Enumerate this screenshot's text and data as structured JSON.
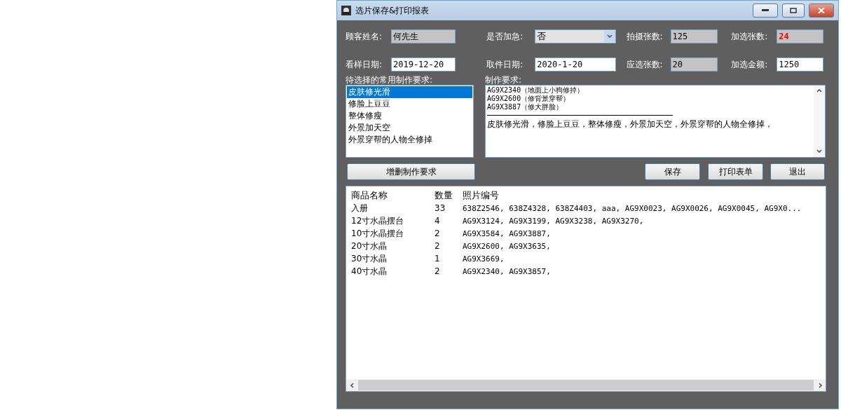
{
  "window": {
    "title": "选片保存&打印报表"
  },
  "fields": [
    {
      "label": "顾客姓名:",
      "value": "何先生",
      "kind": "readonly",
      "highlight": false
    },
    {
      "label": "是否加急:",
      "value": "否",
      "kind": "combo",
      "highlight": false
    },
    {
      "label": "拍摄张数:",
      "value": "125",
      "kind": "readonly",
      "highlight": false
    },
    {
      "label": "加选张数:",
      "value": "24",
      "kind": "readonly",
      "highlight": true
    },
    {
      "label": "看样日期:",
      "value": "2019-12-20",
      "kind": "input",
      "highlight": false
    },
    {
      "label": "取件日期:",
      "value": "2020-1-20",
      "kind": "input",
      "highlight": false
    },
    {
      "label": "应选张数:",
      "value": "20",
      "kind": "readonly",
      "highlight": false
    },
    {
      "label": "加选金额:",
      "value": "1250",
      "kind": "input",
      "highlight": false
    }
  ],
  "common_requirements": {
    "label": "待选择的常用制作要求:",
    "items": [
      {
        "text": "皮肤修光滑",
        "selected": true
      },
      {
        "text": "修脸上豆豆",
        "selected": false
      },
      {
        "text": "整体修瘦",
        "selected": false
      },
      {
        "text": "外景加天空",
        "selected": false
      },
      {
        "text": "外景穿帮的人物全修掉",
        "selected": false
      }
    ]
  },
  "requirements": {
    "label": "制作要求:",
    "photo_notes": [
      "AG9X2340（地面上小狗修掉）",
      "AG9X2600（修背景穿帮）",
      "AG9X3887（修大胖脸）"
    ],
    "summary": "皮肤修光滑，修脸上豆豆，整体修瘦，外景加天空，外景穿帮的人物全修掉，"
  },
  "edit_button": "增删制作要求",
  "buttons": [
    "保存",
    "打印表单",
    "退出"
  ],
  "table": {
    "columns": [
      "商品名称",
      "数量",
      "照片编号"
    ],
    "rows": [
      [
        "入册",
        "33",
        "638Z2546, 638Z4328, 638Z4403, aaa, AG9X0023, AG9X0026, AG9X0045, AG9X0..."
      ],
      [
        "12寸水晶摆台",
        "4",
        "AG9X3124, AG9X3199, AG9X3238, AG9X3270,"
      ],
      [
        "10寸水晶摆台",
        "2",
        "AG9X3584, AG9X3887,"
      ],
      [
        "20寸水晶",
        "2",
        "AG9X2600, AG9X3635,"
      ],
      [
        "30寸水晶",
        "1",
        "AG9X3669,"
      ],
      [
        "40寸水晶",
        "2",
        "AG9X2340, AG9X3857,"
      ]
    ]
  }
}
